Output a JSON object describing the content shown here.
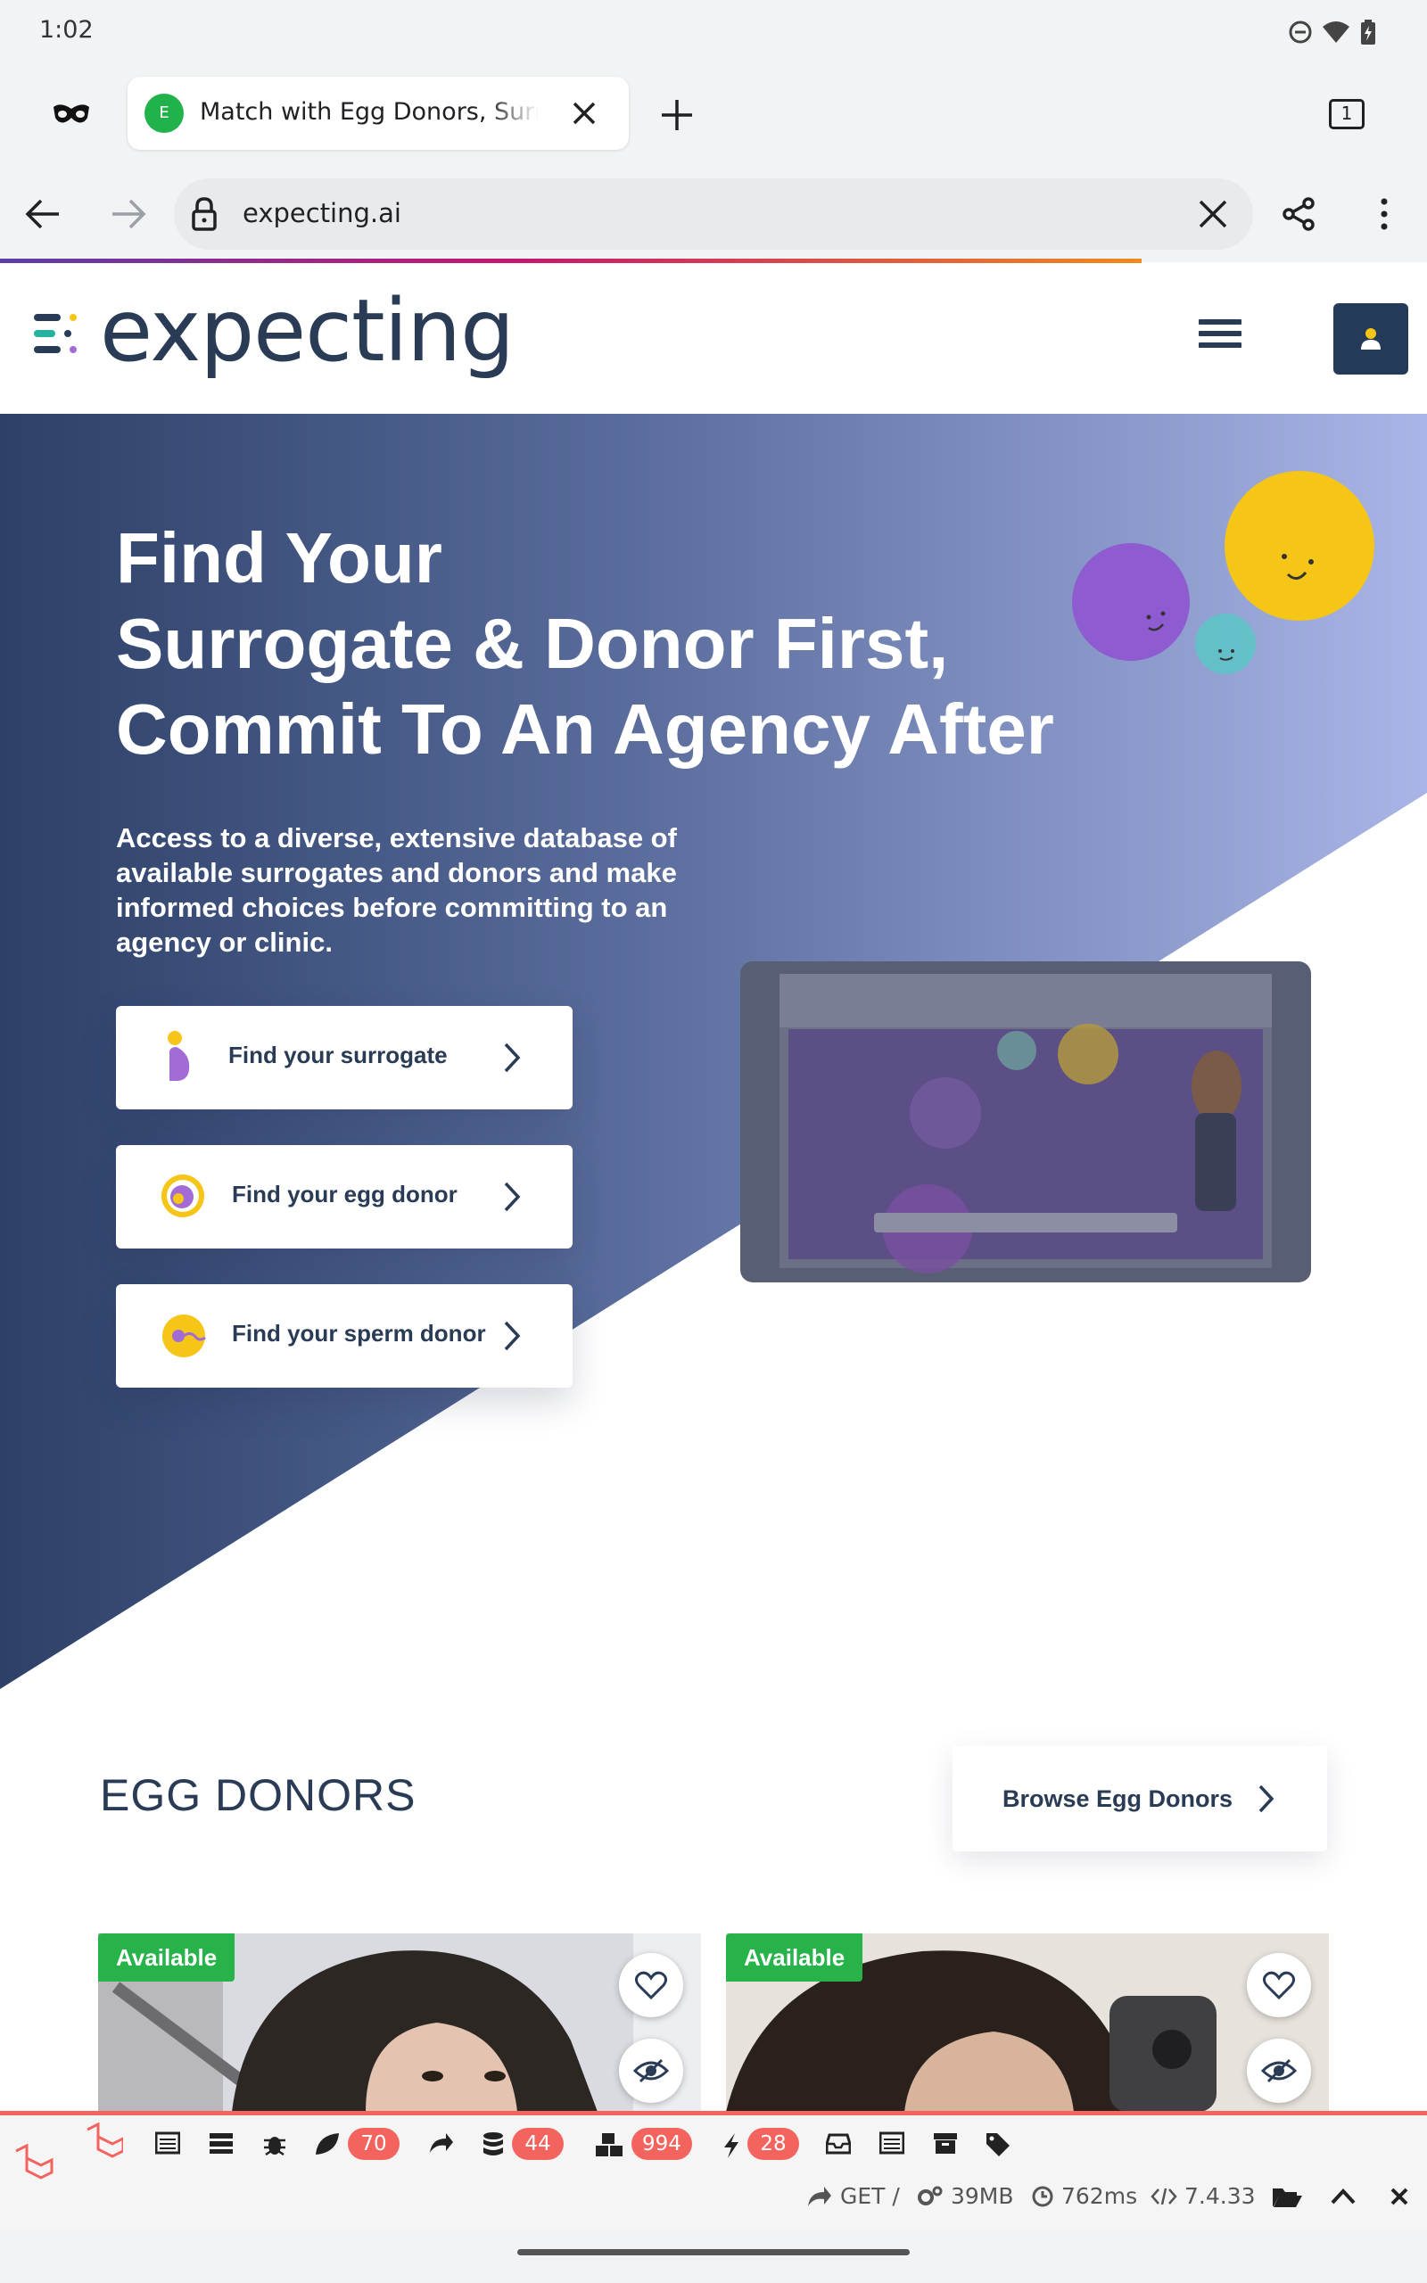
{
  "status_bar": {
    "time": "1:02"
  },
  "browser": {
    "tab_favicon_letter": "E",
    "tab_title": "Match with Egg Donors, Surrogates",
    "tab_count": "1",
    "url": "expecting.ai"
  },
  "site": {
    "logo_text": "expecting"
  },
  "hero": {
    "title_lines": [
      "Find Your",
      "Surrogate & Donor First,",
      "Commit To An Agency After"
    ],
    "description": "Access to a diverse, extensive database of available surrogates and donors and make informed choices before committing to an agency or clinic.",
    "cta_surrogate": "Find your surrogate",
    "cta_egg_donor": "Find your egg donor",
    "cta_sperm_donor": "Find your sperm donor"
  },
  "egg_donors": {
    "section_title": "EGG DONORS",
    "browse_label": "Browse Egg Donors",
    "cards": [
      {
        "badge": "Available"
      },
      {
        "badge": "Available"
      }
    ]
  },
  "debugbar": {
    "views_count": "70",
    "queries_count": "44",
    "models_count": "994",
    "events_count": "28",
    "method_route": "GET /",
    "memory": "39MB",
    "duration": "762ms",
    "php_version": "7.4.33"
  },
  "colors": {
    "brand_navy": "#2a3b55",
    "badge_green": "#27b24a",
    "debug_red": "#f4645f"
  }
}
